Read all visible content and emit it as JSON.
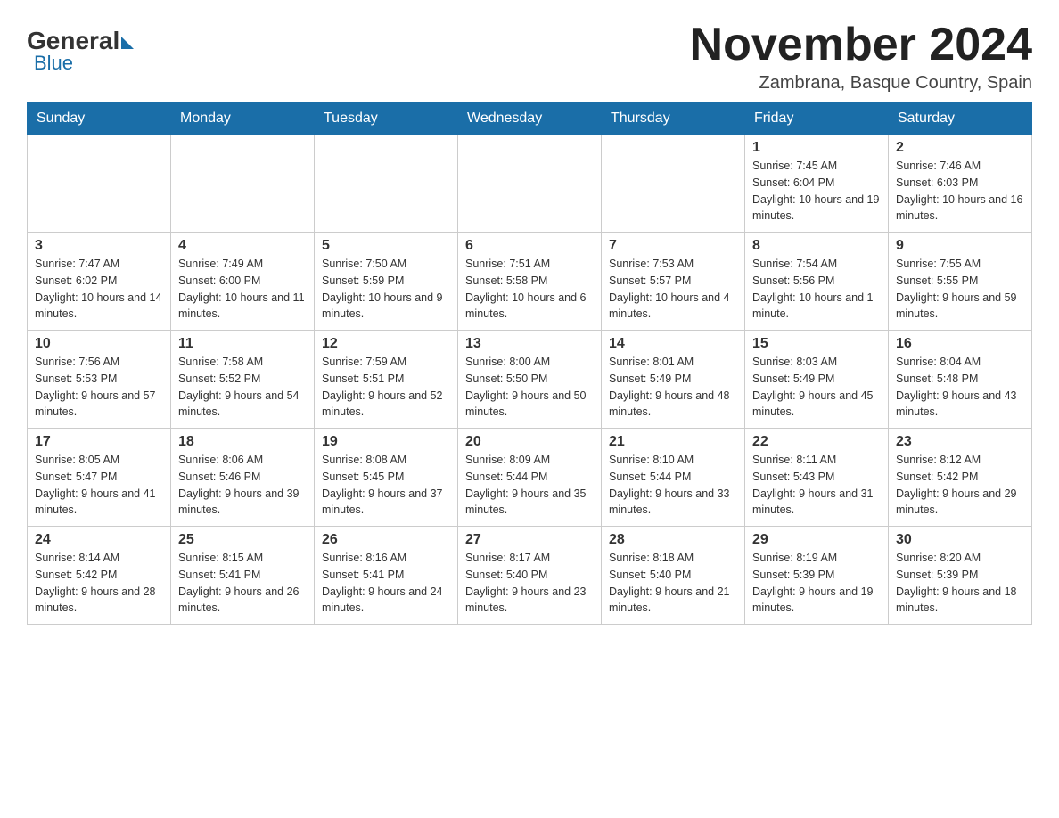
{
  "header": {
    "logo_general": "General",
    "logo_blue": "Blue",
    "month_title": "November 2024",
    "location": "Zambrana, Basque Country, Spain"
  },
  "days_of_week": [
    "Sunday",
    "Monday",
    "Tuesday",
    "Wednesday",
    "Thursday",
    "Friday",
    "Saturday"
  ],
  "weeks": [
    [
      {
        "day": "",
        "sunrise": "",
        "sunset": "",
        "daylight": ""
      },
      {
        "day": "",
        "sunrise": "",
        "sunset": "",
        "daylight": ""
      },
      {
        "day": "",
        "sunrise": "",
        "sunset": "",
        "daylight": ""
      },
      {
        "day": "",
        "sunrise": "",
        "sunset": "",
        "daylight": ""
      },
      {
        "day": "",
        "sunrise": "",
        "sunset": "",
        "daylight": ""
      },
      {
        "day": "1",
        "sunrise": "Sunrise: 7:45 AM",
        "sunset": "Sunset: 6:04 PM",
        "daylight": "Daylight: 10 hours and 19 minutes."
      },
      {
        "day": "2",
        "sunrise": "Sunrise: 7:46 AM",
        "sunset": "Sunset: 6:03 PM",
        "daylight": "Daylight: 10 hours and 16 minutes."
      }
    ],
    [
      {
        "day": "3",
        "sunrise": "Sunrise: 7:47 AM",
        "sunset": "Sunset: 6:02 PM",
        "daylight": "Daylight: 10 hours and 14 minutes."
      },
      {
        "day": "4",
        "sunrise": "Sunrise: 7:49 AM",
        "sunset": "Sunset: 6:00 PM",
        "daylight": "Daylight: 10 hours and 11 minutes."
      },
      {
        "day": "5",
        "sunrise": "Sunrise: 7:50 AM",
        "sunset": "Sunset: 5:59 PM",
        "daylight": "Daylight: 10 hours and 9 minutes."
      },
      {
        "day": "6",
        "sunrise": "Sunrise: 7:51 AM",
        "sunset": "Sunset: 5:58 PM",
        "daylight": "Daylight: 10 hours and 6 minutes."
      },
      {
        "day": "7",
        "sunrise": "Sunrise: 7:53 AM",
        "sunset": "Sunset: 5:57 PM",
        "daylight": "Daylight: 10 hours and 4 minutes."
      },
      {
        "day": "8",
        "sunrise": "Sunrise: 7:54 AM",
        "sunset": "Sunset: 5:56 PM",
        "daylight": "Daylight: 10 hours and 1 minute."
      },
      {
        "day": "9",
        "sunrise": "Sunrise: 7:55 AM",
        "sunset": "Sunset: 5:55 PM",
        "daylight": "Daylight: 9 hours and 59 minutes."
      }
    ],
    [
      {
        "day": "10",
        "sunrise": "Sunrise: 7:56 AM",
        "sunset": "Sunset: 5:53 PM",
        "daylight": "Daylight: 9 hours and 57 minutes."
      },
      {
        "day": "11",
        "sunrise": "Sunrise: 7:58 AM",
        "sunset": "Sunset: 5:52 PM",
        "daylight": "Daylight: 9 hours and 54 minutes."
      },
      {
        "day": "12",
        "sunrise": "Sunrise: 7:59 AM",
        "sunset": "Sunset: 5:51 PM",
        "daylight": "Daylight: 9 hours and 52 minutes."
      },
      {
        "day": "13",
        "sunrise": "Sunrise: 8:00 AM",
        "sunset": "Sunset: 5:50 PM",
        "daylight": "Daylight: 9 hours and 50 minutes."
      },
      {
        "day": "14",
        "sunrise": "Sunrise: 8:01 AM",
        "sunset": "Sunset: 5:49 PM",
        "daylight": "Daylight: 9 hours and 48 minutes."
      },
      {
        "day": "15",
        "sunrise": "Sunrise: 8:03 AM",
        "sunset": "Sunset: 5:49 PM",
        "daylight": "Daylight: 9 hours and 45 minutes."
      },
      {
        "day": "16",
        "sunrise": "Sunrise: 8:04 AM",
        "sunset": "Sunset: 5:48 PM",
        "daylight": "Daylight: 9 hours and 43 minutes."
      }
    ],
    [
      {
        "day": "17",
        "sunrise": "Sunrise: 8:05 AM",
        "sunset": "Sunset: 5:47 PM",
        "daylight": "Daylight: 9 hours and 41 minutes."
      },
      {
        "day": "18",
        "sunrise": "Sunrise: 8:06 AM",
        "sunset": "Sunset: 5:46 PM",
        "daylight": "Daylight: 9 hours and 39 minutes."
      },
      {
        "day": "19",
        "sunrise": "Sunrise: 8:08 AM",
        "sunset": "Sunset: 5:45 PM",
        "daylight": "Daylight: 9 hours and 37 minutes."
      },
      {
        "day": "20",
        "sunrise": "Sunrise: 8:09 AM",
        "sunset": "Sunset: 5:44 PM",
        "daylight": "Daylight: 9 hours and 35 minutes."
      },
      {
        "day": "21",
        "sunrise": "Sunrise: 8:10 AM",
        "sunset": "Sunset: 5:44 PM",
        "daylight": "Daylight: 9 hours and 33 minutes."
      },
      {
        "day": "22",
        "sunrise": "Sunrise: 8:11 AM",
        "sunset": "Sunset: 5:43 PM",
        "daylight": "Daylight: 9 hours and 31 minutes."
      },
      {
        "day": "23",
        "sunrise": "Sunrise: 8:12 AM",
        "sunset": "Sunset: 5:42 PM",
        "daylight": "Daylight: 9 hours and 29 minutes."
      }
    ],
    [
      {
        "day": "24",
        "sunrise": "Sunrise: 8:14 AM",
        "sunset": "Sunset: 5:42 PM",
        "daylight": "Daylight: 9 hours and 28 minutes."
      },
      {
        "day": "25",
        "sunrise": "Sunrise: 8:15 AM",
        "sunset": "Sunset: 5:41 PM",
        "daylight": "Daylight: 9 hours and 26 minutes."
      },
      {
        "day": "26",
        "sunrise": "Sunrise: 8:16 AM",
        "sunset": "Sunset: 5:41 PM",
        "daylight": "Daylight: 9 hours and 24 minutes."
      },
      {
        "day": "27",
        "sunrise": "Sunrise: 8:17 AM",
        "sunset": "Sunset: 5:40 PM",
        "daylight": "Daylight: 9 hours and 23 minutes."
      },
      {
        "day": "28",
        "sunrise": "Sunrise: 8:18 AM",
        "sunset": "Sunset: 5:40 PM",
        "daylight": "Daylight: 9 hours and 21 minutes."
      },
      {
        "day": "29",
        "sunrise": "Sunrise: 8:19 AM",
        "sunset": "Sunset: 5:39 PM",
        "daylight": "Daylight: 9 hours and 19 minutes."
      },
      {
        "day": "30",
        "sunrise": "Sunrise: 8:20 AM",
        "sunset": "Sunset: 5:39 PM",
        "daylight": "Daylight: 9 hours and 18 minutes."
      }
    ]
  ]
}
